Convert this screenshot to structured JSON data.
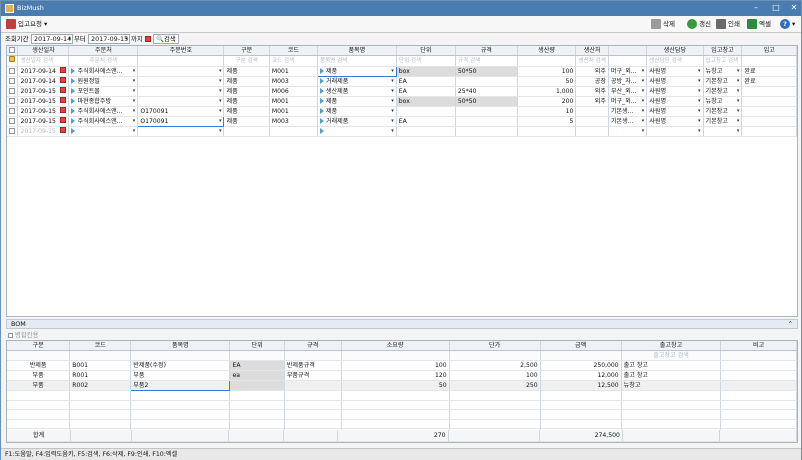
{
  "window": {
    "title": "BizMush"
  },
  "toolbar": {
    "menu_label": "입고요청",
    "delete": "삭제",
    "refresh": "갱신",
    "print": "인쇄",
    "excel": "엑셀",
    "help": "?"
  },
  "filter": {
    "period_label": "조회기간",
    "from": "2017-09-14",
    "from_suffix": "부터",
    "to": "2017-09-15",
    "to_suffix": "까지",
    "search": "검색"
  },
  "main": {
    "headers": [
      "생산일자",
      "주문처",
      "주문번호",
      "구분",
      "코드",
      "품목명",
      "단위",
      "규격",
      "생산량",
      "생산처",
      "",
      "생산담당",
      "입고창고",
      "입고"
    ],
    "placeholders": [
      "생산일자 검색",
      "주문처 검색",
      "",
      "구분 검색",
      "코드 검색",
      "품목명 검색",
      "단위 검색",
      "규격 검색",
      "",
      "생산처 검색",
      "",
      "생산담당 검색",
      "입고창고 검색",
      ""
    ],
    "rows": [
      {
        "date": "2017-09-14",
        "client": "주식회사에스앤...",
        "order": "",
        "type": "제품",
        "code": "M001",
        "item": "제품",
        "unit": "box",
        "spec": "50*50",
        "qty": "100",
        "maker": "외주",
        "maker2": "머구_외...",
        "staff": "사원명",
        "wh": "뉴창고",
        "status": "완료"
      },
      {
        "date": "2017-09-14",
        "client": "원원정밀",
        "order": "",
        "type": "제품",
        "code": "M003",
        "item": "거래제품",
        "unit": "EA",
        "spec": "",
        "qty": "50",
        "maker": "공장",
        "maker2": "공방_자...",
        "staff": "사원명",
        "wh": "기본창고",
        "status": "완료"
      },
      {
        "date": "2017-09-15",
        "client": "포인트몰",
        "order": "",
        "type": "제품",
        "code": "M006",
        "item": "생산제품",
        "unit": "EA",
        "spec": "25*40",
        "qty": "1,000",
        "maker": "외주",
        "maker2": "부산_외...",
        "staff": "사원명",
        "wh": "기본창고",
        "status": ""
      },
      {
        "date": "2017-09-15",
        "client": "마현종합주방",
        "order": "",
        "type": "제품",
        "code": "M001",
        "item": "제품",
        "unit": "box",
        "spec": "50*50",
        "qty": "200",
        "maker": "외주",
        "maker2": "머구_외...",
        "staff": "사원명",
        "wh": "뉴창고",
        "status": ""
      },
      {
        "date": "2017-09-15",
        "client": "주식회사에스앤...",
        "order": "O170091",
        "type": "제품",
        "code": "M001",
        "item": "제품",
        "unit": "",
        "spec": "",
        "qty": "10",
        "maker": "",
        "maker2": "기본생...",
        "staff": "사원명",
        "wh": "기본창고",
        "status": ""
      },
      {
        "date": "2017-09-15",
        "client": "주식회사에스앤...",
        "order": "O170091",
        "type": "제품",
        "code": "M003",
        "item": "거래제품",
        "unit": "EA",
        "spec": "",
        "qty": "5",
        "maker": "",
        "maker2": "기본생...",
        "staff": "사원명",
        "wh": "기본창고",
        "status": ""
      },
      {
        "date": "2017-09-15",
        "client": "",
        "order": "",
        "type": "",
        "code": "",
        "item": "",
        "unit": "",
        "spec": "",
        "qty": "",
        "maker": "",
        "maker2": "",
        "staff": "",
        "wh": "",
        "status": ""
      }
    ]
  },
  "bom": {
    "title": "BOM",
    "toggle_label": "병합칸용",
    "headers": [
      "구분",
      "코드",
      "품목명",
      "단위",
      "규격",
      "소요량",
      "단가",
      "금액",
      "출고창고",
      "비고"
    ],
    "placeholders": [
      "",
      "",
      "",
      "",
      "",
      "",
      "",
      "",
      "출고창고 검색",
      ""
    ],
    "rows": [
      {
        "type": "반제품",
        "code": "B001",
        "item": "반제품(수정)",
        "unit": "EA",
        "spec": "반제품규격",
        "need": "100",
        "price": "2,500",
        "amount": "250,000",
        "wh": "출고 창고",
        "note": ""
      },
      {
        "type": "부품",
        "code": "R001",
        "item": "부품",
        "unit": "ea",
        "spec": "부품규격",
        "need": "120",
        "price": "100",
        "amount": "12,000",
        "wh": "출고 창고",
        "note": ""
      },
      {
        "type": "부품",
        "code": "R002",
        "item": "부품2",
        "unit": "",
        "spec": "",
        "need": "50",
        "price": "250",
        "amount": "12,500",
        "wh": "뉴창고",
        "note": ""
      }
    ],
    "sum": {
      "label": "합계",
      "need": "270",
      "amount": "274,500"
    }
  },
  "status_bar": "F1:도움말, F4:입력도움키, F5:검색, F6:삭제, F9:인쇄, F10:엑셀"
}
